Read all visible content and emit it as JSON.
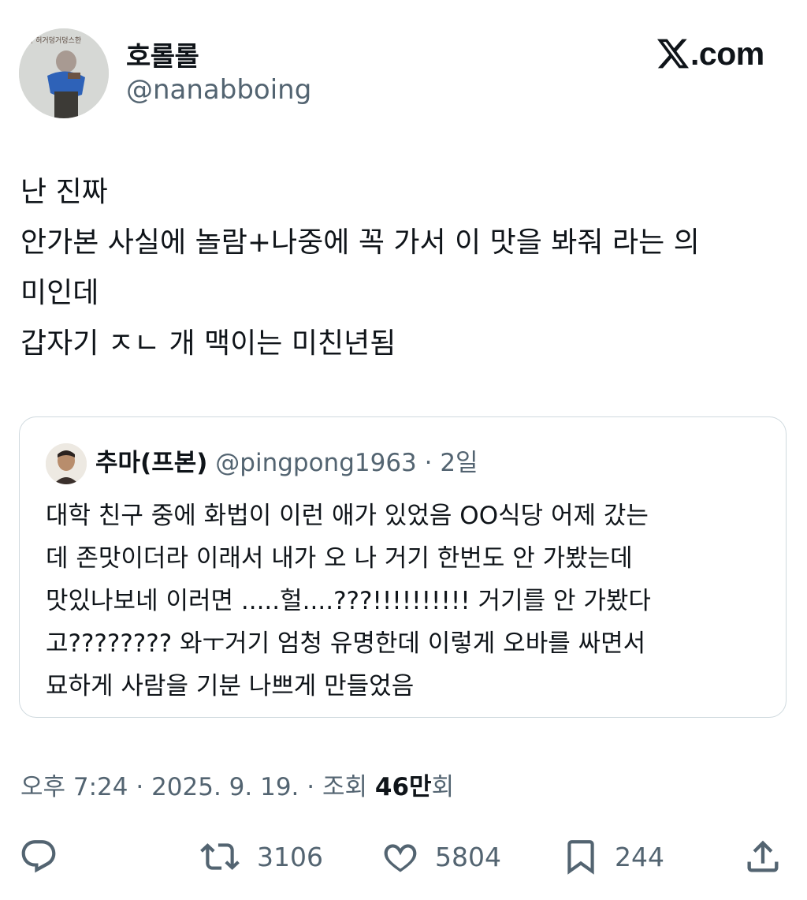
{
  "author": {
    "name": "호롤롤",
    "handle": "@nanabboing"
  },
  "brand": {
    "logo_text": ".com",
    "icon": "x-logo-icon"
  },
  "tweet": {
    "lines": [
      "난 진짜",
      "안가본 사실에 놀람+나중에 꼭 가서 이 맛을 봐줘 라는 의",
      "미인데",
      "갑자기 ㅈㄴ 개 맥이는 미친년됨"
    ]
  },
  "quote": {
    "name": "추마(프본)",
    "handle": "@pingpong1963",
    "separator": " · ",
    "time": "2일",
    "lines": [
      "대학 친구 중에 화법이 이런 애가 있었음 OO식당 어제 갔는",
      "데 존맛이더라 이래서 내가 오 나 거기 한번도 안 가봤는데",
      "맛있나보네 이러면 .....헐....???!!!!!!!!!! 거기를 안 가봤다",
      "고???????? 와ㅜ거기 엄청 유명한데 이렇게 오바를 싸면서",
      "묘하게 사람을 기분 나쁘게 만들었음"
    ]
  },
  "meta": {
    "time": "오후 7:24",
    "sep1": " · ",
    "date": "2025. 9. 19.",
    "sep2": " · ",
    "views_label": "조회 ",
    "views_count": "46만",
    "views_unit": "회"
  },
  "actions": {
    "reply": {
      "icon": "reply-icon"
    },
    "retweet": {
      "icon": "retweet-icon",
      "count": "3106"
    },
    "like": {
      "icon": "heart-icon",
      "count": "5804"
    },
    "bookmark": {
      "icon": "bookmark-icon",
      "count": "244"
    },
    "share": {
      "icon": "share-icon"
    }
  },
  "colors": {
    "text": "#0f1419",
    "secondary": "#536471",
    "border": "#cfd9de"
  }
}
